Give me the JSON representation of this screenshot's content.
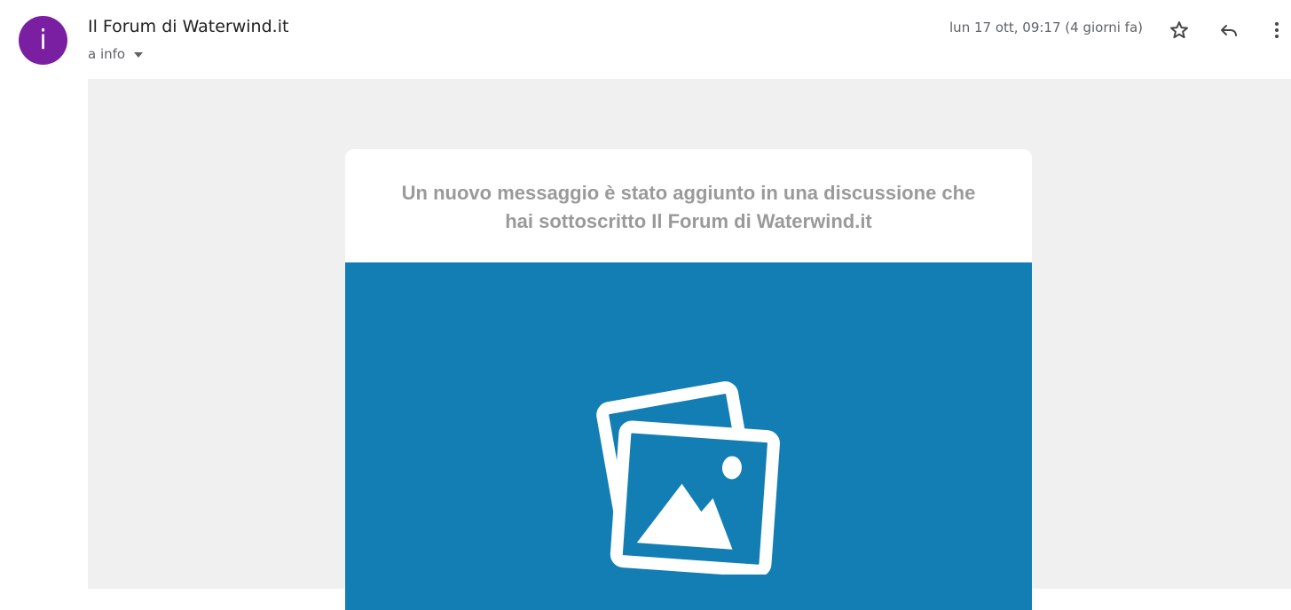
{
  "sender": {
    "avatar_letter": "i",
    "name": "Il Forum di Waterwind.it",
    "recipient": "a info"
  },
  "message": {
    "date": "lun 17 ott, 09:17 (4 giorni fa)"
  },
  "actions": {
    "star_icon": "star-icon",
    "reply_icon": "reply-icon",
    "more_icon": "more-vert-icon"
  },
  "card": {
    "headline_line1": "Un nuovo messaggio è stato aggiunto in una discussione che",
    "headline_line2": "hai sottoscritto Il Forum di Waterwind.it",
    "image_icon": "image-placeholder-icon"
  },
  "colors": {
    "avatar": "#7b1fa2",
    "banner": "#137eb3",
    "body_background": "#f0f0f0",
    "headline_text": "#9a9a9a"
  }
}
